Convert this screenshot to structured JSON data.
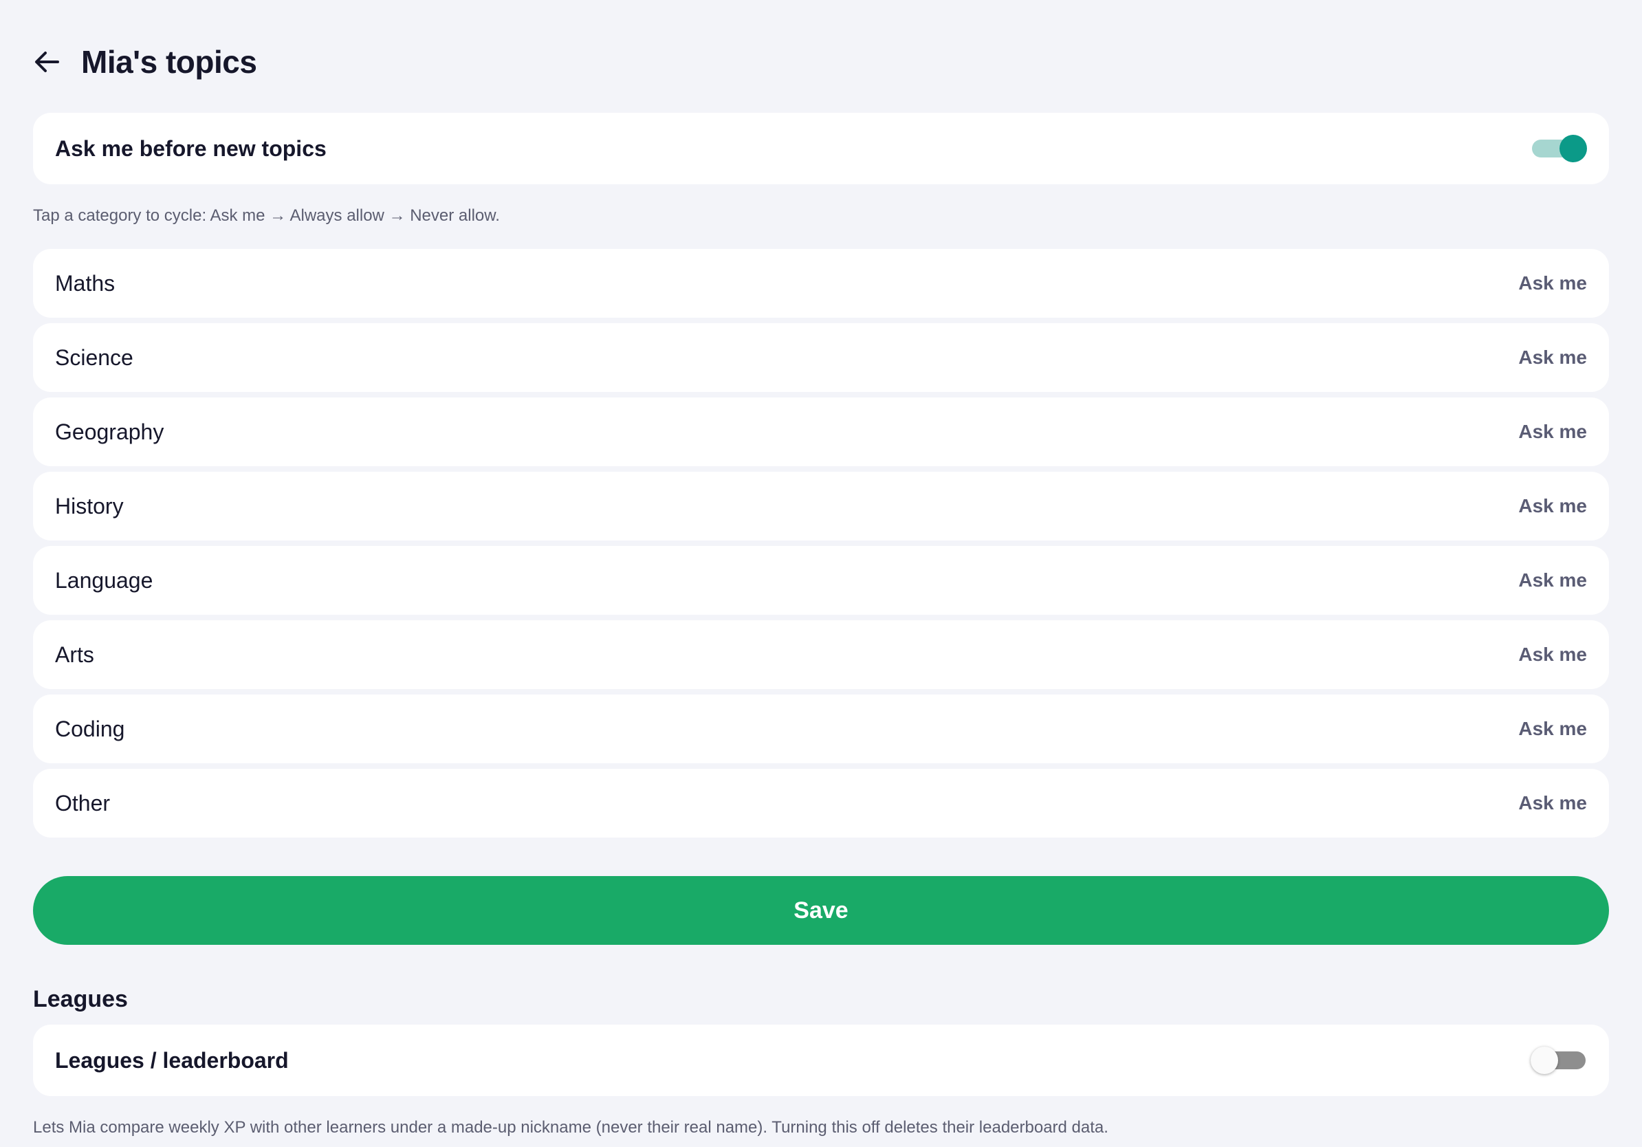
{
  "header": {
    "title": "Mia's topics",
    "back_icon": "arrow-left-icon"
  },
  "ask_toggle": {
    "label": "Ask me before new topics",
    "enabled": true
  },
  "hint": "Tap a category to cycle: Ask me → Always allow → Never allow.",
  "topics": [
    {
      "name": "Maths",
      "status": "Ask me"
    },
    {
      "name": "Science",
      "status": "Ask me"
    },
    {
      "name": "Geography",
      "status": "Ask me"
    },
    {
      "name": "History",
      "status": "Ask me"
    },
    {
      "name": "Language",
      "status": "Ask me"
    },
    {
      "name": "Arts",
      "status": "Ask me"
    },
    {
      "name": "Coding",
      "status": "Ask me"
    },
    {
      "name": "Other",
      "status": "Ask me"
    }
  ],
  "save_label": "Save",
  "leagues": {
    "section_title": "Leagues",
    "toggle_label": "Leagues / leaderboard",
    "enabled": false,
    "description": "Lets Mia compare weekly XP with other learners under a made-up nickname (never their real name). Turning this off deletes their leaderboard data."
  },
  "colors": {
    "accent": "#0b9a88",
    "save": "#19aa67",
    "background": "#f3f4f9"
  }
}
